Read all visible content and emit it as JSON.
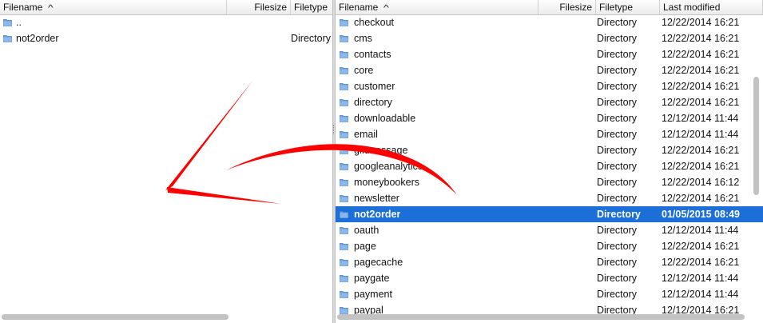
{
  "left": {
    "headers": {
      "filename": "Filename",
      "filesize": "Filesize",
      "filetype": "Filetype"
    },
    "rows": [
      {
        "name": "..",
        "type": ""
      },
      {
        "name": "not2order",
        "type": "Directory"
      }
    ]
  },
  "right": {
    "headers": {
      "filename": "Filename",
      "filesize": "Filesize",
      "filetype": "Filetype",
      "modified": "Last modified"
    },
    "rows": [
      {
        "name": "checkout",
        "type": "Directory",
        "modified": "12/22/2014 16:21"
      },
      {
        "name": "cms",
        "type": "Directory",
        "modified": "12/22/2014 16:21"
      },
      {
        "name": "contacts",
        "type": "Directory",
        "modified": "12/22/2014 16:21"
      },
      {
        "name": "core",
        "type": "Directory",
        "modified": "12/22/2014 16:21"
      },
      {
        "name": "customer",
        "type": "Directory",
        "modified": "12/22/2014 16:21"
      },
      {
        "name": "directory",
        "type": "Directory",
        "modified": "12/22/2014 16:21"
      },
      {
        "name": "downloadable",
        "type": "Directory",
        "modified": "12/12/2014 11:44"
      },
      {
        "name": "email",
        "type": "Directory",
        "modified": "12/12/2014 11:44"
      },
      {
        "name": "giftmessage",
        "type": "Directory",
        "modified": "12/22/2014 16:21"
      },
      {
        "name": "googleanalytics",
        "type": "Directory",
        "modified": "12/22/2014 16:21"
      },
      {
        "name": "moneybookers",
        "type": "Directory",
        "modified": "12/22/2014 16:12"
      },
      {
        "name": "newsletter",
        "type": "Directory",
        "modified": "12/22/2014 16:21"
      },
      {
        "name": "not2order",
        "type": "Directory",
        "modified": "01/05/2015 08:49",
        "selected": true
      },
      {
        "name": "oauth",
        "type": "Directory",
        "modified": "12/12/2014 11:44"
      },
      {
        "name": "page",
        "type": "Directory",
        "modified": "12/22/2014 16:21"
      },
      {
        "name": "pagecache",
        "type": "Directory",
        "modified": "12/22/2014 16:21"
      },
      {
        "name": "paygate",
        "type": "Directory",
        "modified": "12/12/2014 11:44"
      },
      {
        "name": "payment",
        "type": "Directory",
        "modified": "12/12/2014 11:44"
      },
      {
        "name": "paypal",
        "type": "Directory",
        "modified": "12/12/2014 16:21"
      }
    ]
  },
  "icons": {
    "folder": "folder-icon",
    "sort": "sort-ascending-icon",
    "annotation": "red-arrow-annotation"
  },
  "colors": {
    "selection": "#1c6fd8",
    "folder": "#6fa3e0",
    "annotation": "#ff0000"
  }
}
